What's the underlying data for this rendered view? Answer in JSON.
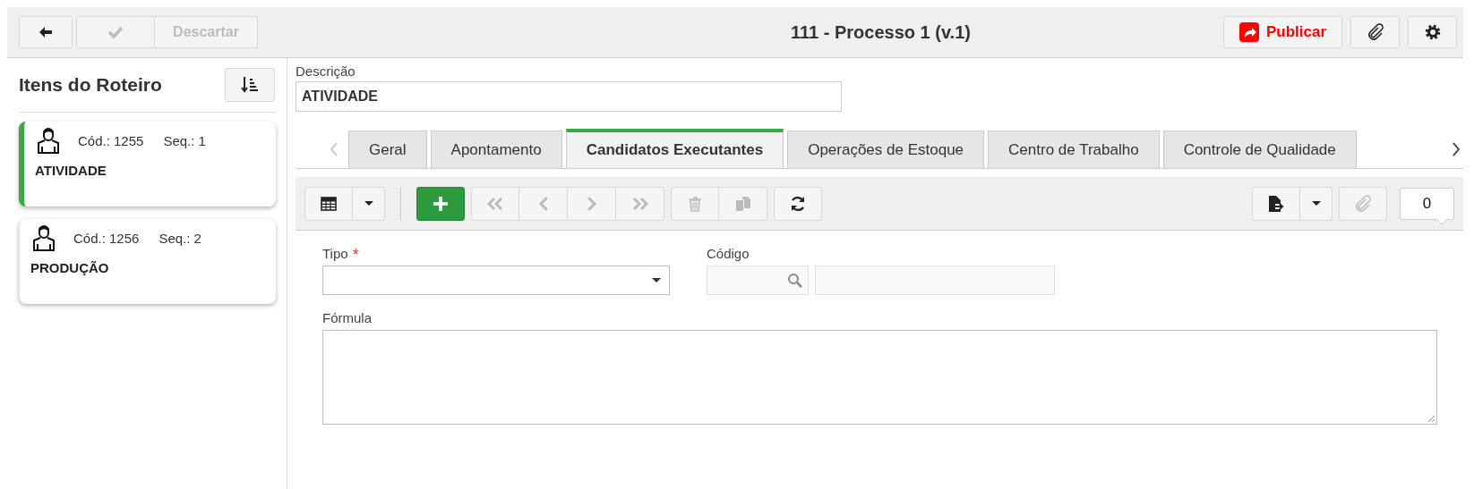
{
  "header": {
    "title": "111 - Processo 1 (v.1)",
    "left_actions": [
      {
        "kind": "back",
        "disabled": false
      },
      {
        "kind": "confirm",
        "disabled": true
      },
      {
        "kind": "discard",
        "label": "Descartar",
        "disabled": true
      }
    ],
    "right_actions": [
      {
        "kind": "publish",
        "label": "Publicar"
      },
      {
        "kind": "attach"
      },
      {
        "kind": "settings"
      }
    ]
  },
  "sidebar": {
    "title": "Itens do Roteiro",
    "items": [
      {
        "code": "Cód.: 1255",
        "seq": "Seq.: 1",
        "name": "ATIVIDADE",
        "selected": true
      },
      {
        "code": "Cód.: 1256",
        "seq": "Seq.: 2",
        "name": "PRODUÇÃO",
        "selected": false
      }
    ]
  },
  "description": {
    "label": "Descrição",
    "value": "ATIVIDADE"
  },
  "tabs": [
    {
      "label": "Geral",
      "selected": false
    },
    {
      "label": "Apontamento",
      "selected": false
    },
    {
      "label": "Candidatos Executantes",
      "selected": true
    },
    {
      "label": "Operações de Estoque",
      "selected": false
    },
    {
      "label": "Centro de Trabalho",
      "selected": false
    },
    {
      "label": "Controle de Qualidade",
      "selected": false
    }
  ],
  "toolbar": {
    "left": [
      {
        "kind": "grid",
        "disabled": false
      },
      {
        "kind": "caret",
        "disabled": false
      },
      {
        "kind": "add",
        "disabled": false
      },
      {
        "kind": "first",
        "disabled": true
      },
      {
        "kind": "prev",
        "disabled": true
      },
      {
        "kind": "next",
        "disabled": true
      },
      {
        "kind": "last",
        "disabled": true
      },
      {
        "kind": "delete",
        "disabled": true
      },
      {
        "kind": "copy",
        "disabled": true
      },
      {
        "kind": "refresh",
        "disabled": false
      }
    ],
    "right": [
      {
        "kind": "export",
        "disabled": false
      },
      {
        "kind": "caret",
        "disabled": false
      },
      {
        "kind": "attach",
        "disabled": true
      }
    ],
    "count": "0"
  },
  "form": {
    "type": {
      "label": "Tipo",
      "required": true,
      "required_mark": "*"
    },
    "code": {
      "label": "Código"
    },
    "formula": {
      "label": "Fórmula"
    }
  }
}
